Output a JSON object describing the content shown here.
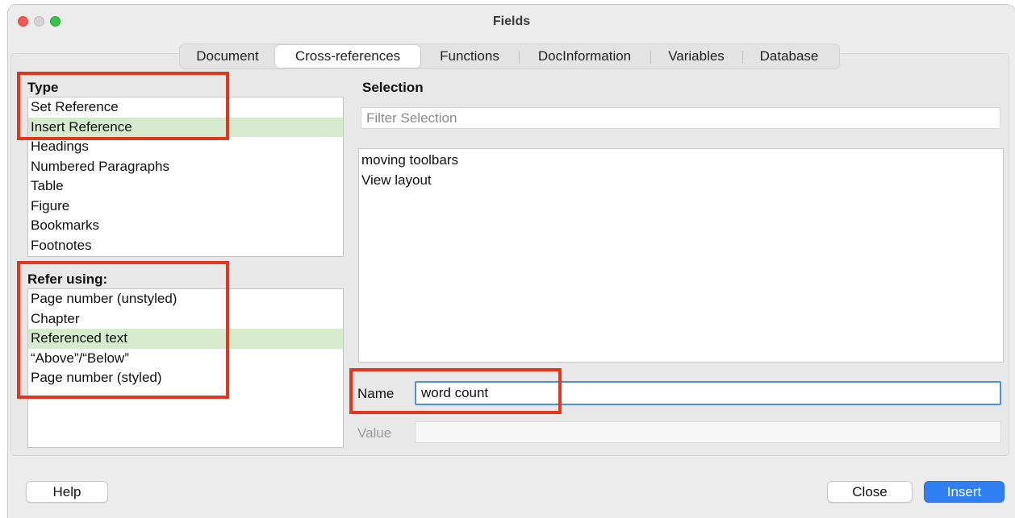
{
  "window": {
    "title": "Fields"
  },
  "tabs": [
    "Document",
    "Cross-references",
    "Functions",
    "DocInformation",
    "Variables",
    "Database"
  ],
  "active_tab": "Cross-references",
  "type": {
    "heading": "Type",
    "items": [
      "Set Reference",
      "Insert Reference",
      "Headings",
      "Numbered Paragraphs",
      "Table",
      "Figure",
      "Bookmarks",
      "Footnotes"
    ],
    "selected": "Insert Reference"
  },
  "refer_using": {
    "heading": "Refer using:",
    "items": [
      "Page number (unstyled)",
      "Chapter",
      "Referenced text",
      "“Above”/“Below”",
      "Page number (styled)"
    ],
    "selected": "Referenced text"
  },
  "selection": {
    "heading": "Selection",
    "filter_placeholder": "Filter Selection",
    "items": [
      "moving toolbars",
      "View layout"
    ]
  },
  "name_field": {
    "label": "Name",
    "value": "word count"
  },
  "value_field": {
    "label": "Value",
    "value": ""
  },
  "buttons": {
    "help": "Help",
    "close": "Close",
    "insert": "Insert"
  },
  "colors": {
    "selected_row": "#d6ebce",
    "highlight_box": "#e0371e",
    "accent": "#2f7ff2"
  }
}
